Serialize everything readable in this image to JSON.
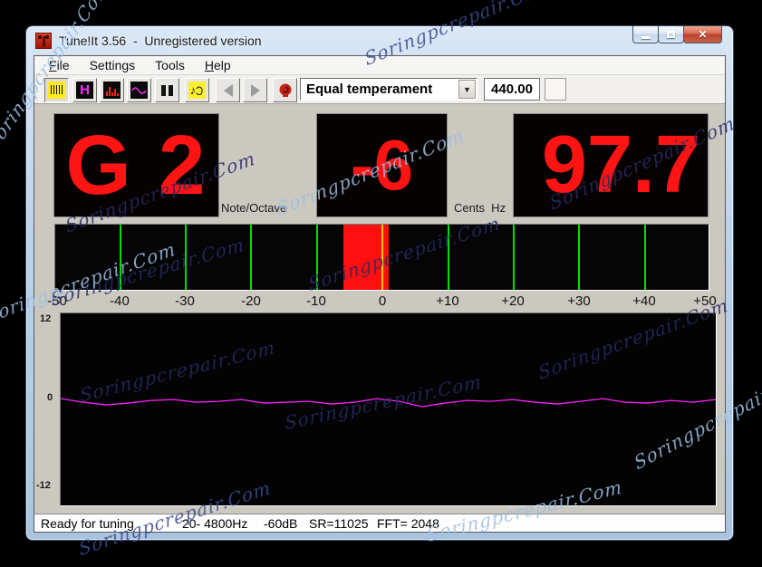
{
  "window": {
    "title": "Tune!It 3.56  -  Unregistered version"
  },
  "menu": {
    "items": [
      {
        "key": "F",
        "rest": "ile"
      },
      {
        "key": "",
        "rest": "Settings"
      },
      {
        "key": "",
        "rest": "Tools"
      },
      {
        "key": "H",
        "rest": "elp"
      }
    ]
  },
  "toolbar": {
    "temperament": "Equal temperament",
    "reference_freq": "440.00",
    "buttons": [
      "strobe-view",
      "harmonics-view",
      "spectrum-view",
      "waveform-view",
      "pause",
      "play-reference-note",
      "previous-note",
      "next-note",
      "listen-mode"
    ]
  },
  "displays": {
    "note": "G 2",
    "note_label": "Note/Octave",
    "cents": "-6",
    "cents_hz_label": "Cents  Hz",
    "frequency": "97.7"
  },
  "meter": {
    "labels": [
      "-50",
      "-40",
      "-30",
      "-20",
      "-10",
      "0",
      "+10",
      "+20",
      "+30",
      "+40",
      "+50"
    ],
    "range": [
      -50,
      50
    ],
    "green_ticks": [
      -40,
      -30,
      -20,
      -10,
      10,
      20,
      30,
      40
    ],
    "indicator": {
      "from": -6,
      "to": 1
    },
    "zero_marker": 0,
    "colors": {
      "tick": "#00dd00",
      "indicator": "#ff0f0f",
      "zero": "#ffcf00",
      "background": "#050505"
    }
  },
  "waveform": {
    "y_labels": [
      "12",
      "0",
      "-12"
    ],
    "trace_color": "#ff22ff",
    "points": [
      [
        0,
        95
      ],
      [
        25,
        99
      ],
      [
        50,
        102
      ],
      [
        75,
        100
      ],
      [
        100,
        97
      ],
      [
        125,
        96
      ],
      [
        150,
        99
      ],
      [
        175,
        98
      ],
      [
        200,
        96
      ],
      [
        225,
        100
      ],
      [
        250,
        99
      ],
      [
        275,
        98
      ],
      [
        300,
        101
      ],
      [
        325,
        99
      ],
      [
        350,
        95
      ],
      [
        375,
        98
      ],
      [
        400,
        104
      ],
      [
        425,
        100
      ],
      [
        450,
        97
      ],
      [
        475,
        98
      ],
      [
        500,
        96
      ],
      [
        525,
        99
      ],
      [
        550,
        101
      ],
      [
        575,
        98
      ],
      [
        600,
        95
      ],
      [
        625,
        99
      ],
      [
        650,
        100
      ],
      [
        675,
        97
      ],
      [
        700,
        99
      ],
      [
        725,
        96
      ]
    ]
  },
  "status": {
    "items": [
      "Ready for tuning",
      "20- 4800Hz",
      "-60dB",
      "SR=11025",
      "FFT= 2048"
    ]
  },
  "watermark": {
    "text": "Soringpcrepair.Com"
  },
  "colors": {
    "display_text": "#ff1414",
    "client_bg": "#cbc8c0",
    "aero_border": "#bdd2ea"
  }
}
